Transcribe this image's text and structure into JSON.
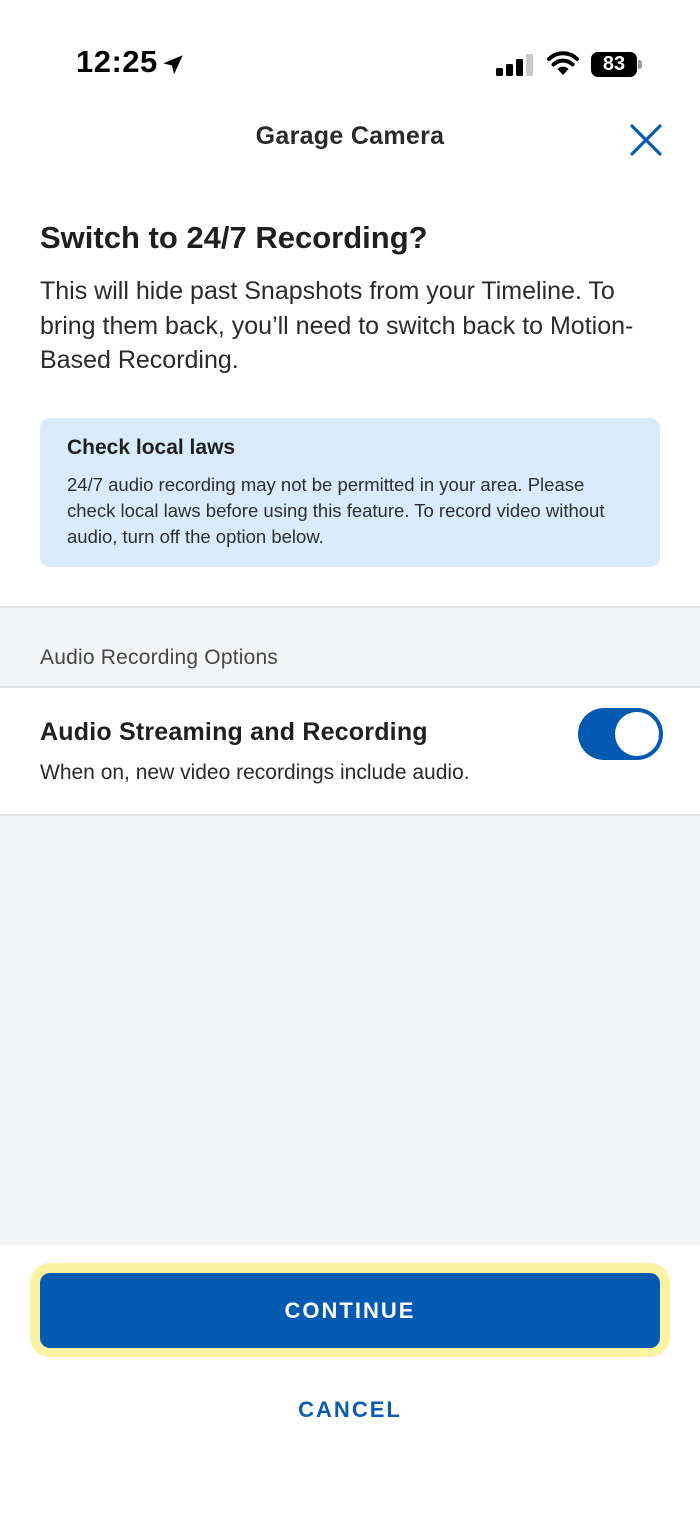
{
  "status_bar": {
    "time": "12:25",
    "battery": "83",
    "icons": [
      "location-arrow-icon",
      "cellular-signal-icon",
      "wifi-icon",
      "battery-icon"
    ]
  },
  "header": {
    "title": "Garage Camera",
    "close_icon": "close-icon"
  },
  "intro": {
    "heading": "Switch to 24/7 Recording?",
    "body": "This will hide past Snapshots from your Timeline. To bring them back, you’ll need to switch back to Motion-Based Recording."
  },
  "notice": {
    "title": "Check local laws",
    "text": "24/7 audio recording may not be permitted in your area. Please check local laws before using this feature. To record video without audio, turn off the option below."
  },
  "audio_options": {
    "section_label": "Audio Recording Options",
    "item": {
      "title": "Audio Streaming and Recording",
      "description": "When on, new video recordings include audio.",
      "enabled": true
    }
  },
  "actions": {
    "continue_label": "CONTINUE",
    "cancel_label": "CANCEL"
  },
  "colors": {
    "accent": "#0459b0",
    "info_bg": "#d9ebfc",
    "section_bg": "#f3f5f7",
    "highlight": "#fbf3a2"
  }
}
